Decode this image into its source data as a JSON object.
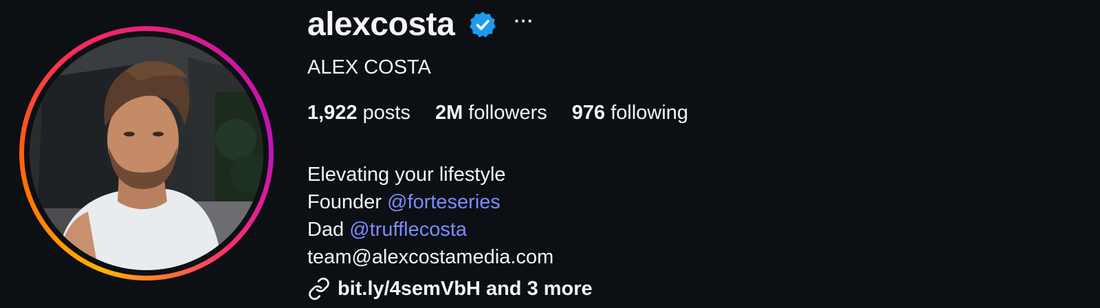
{
  "profile": {
    "username": "alexcosta",
    "verified": true,
    "more_label": "···",
    "full_name": "ALEX COSTA",
    "stats": [
      {
        "count": "1,922",
        "label": " posts"
      },
      {
        "count": "2M",
        "label": " followers"
      },
      {
        "count": "976",
        "label": " following"
      }
    ],
    "bio": {
      "line1": "Elevating your lifestyle",
      "line2_text": "Founder ",
      "line2_mention": "@forteseries",
      "line3_text": "Dad ",
      "line3_mention": "@trufflecosta",
      "line4": "team@alexcostamedia.com"
    },
    "link_text": "bit.ly/4semVbH and 3 more"
  },
  "icons": {
    "verified": "verified-badge-icon",
    "more": "more-options-icon",
    "link": "link-icon"
  },
  "colors": {
    "background": "#0c0f14",
    "text": "#f5f5f5",
    "mention": "#7b8cff",
    "verified": "#1d9bf0",
    "ring_gradient": [
      "#ffb400",
      "#ff6a00",
      "#ff2d55",
      "#c013b8"
    ]
  }
}
